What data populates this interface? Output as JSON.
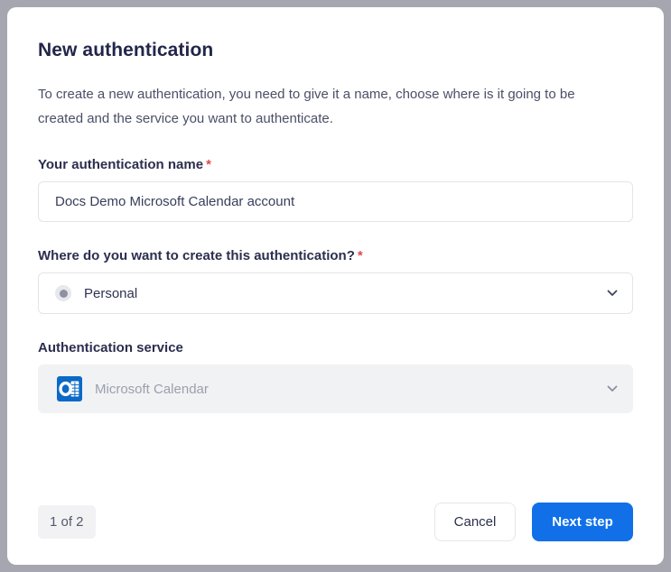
{
  "modal": {
    "title": "New authentication",
    "description": "To create a new authentication, you need to give it a name, choose where is it going to be created and the service you want to authenticate.",
    "fields": {
      "name": {
        "label": "Your authentication name",
        "required_marker": "*",
        "value": "Docs Demo Microsoft Calendar account"
      },
      "location": {
        "label": "Where do you want to create this authentication?",
        "required_marker": "*",
        "selected_option": "Personal"
      },
      "service": {
        "label": "Authentication service",
        "selected_option": "Microsoft Calendar",
        "state": "disabled"
      }
    },
    "footer": {
      "step_indicator": "1 of 2",
      "cancel_label": "Cancel",
      "next_label": "Next step"
    }
  },
  "icons": {
    "person_dot": "gray-dot-avatar",
    "service_logo": "microsoft-outlook-calendar",
    "dropdown": "chevron-down"
  },
  "colors": {
    "accent_blue": "#1170e8",
    "required_red": "#e0484f",
    "outlook_blue": "#0b69c7",
    "backdrop_gray": "#a5a6b0",
    "disabled_bg": "#f1f2f4"
  }
}
